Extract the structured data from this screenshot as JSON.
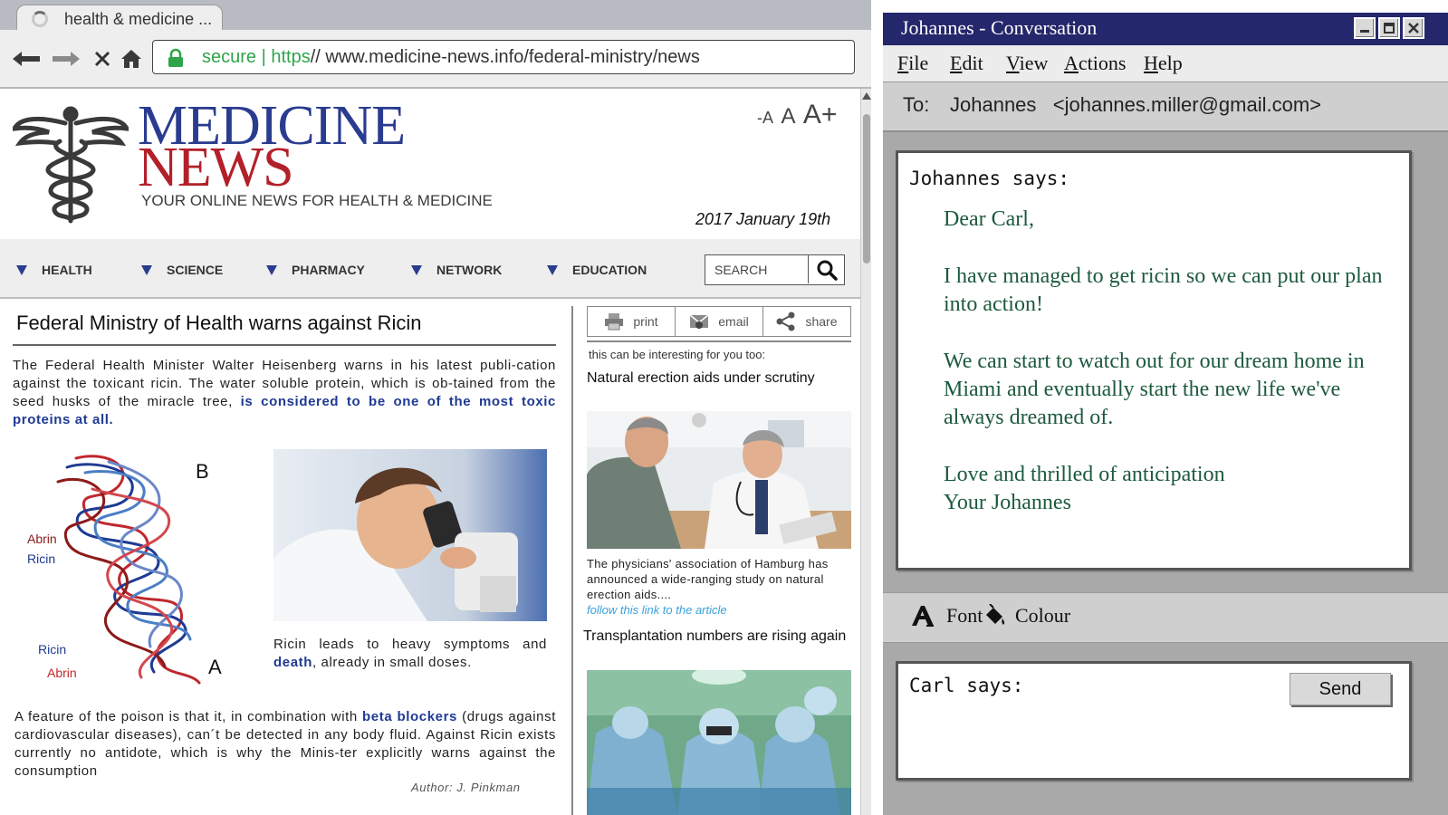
{
  "browser": {
    "tab_title": "health & medicine ...",
    "address": {
      "secure_label": "secure | https",
      "url_rest": "// www.medicine-news.info/federal-ministry/news"
    }
  },
  "site": {
    "brand_line1": "MEDICINE",
    "brand_line2": "NEWS",
    "tagline": "YOUR ONLINE NEWS FOR HEALTH & MEDICINE",
    "font_controls": [
      "-A",
      "A",
      "A+"
    ],
    "date": "2017 January 19th",
    "nav": [
      "HEALTH",
      "SCIENCE",
      "PHARMACY",
      "NETWORK",
      "EDUCATION"
    ],
    "search_placeholder": "SEARCH",
    "colors": {
      "brand_blue": "#2a3c8f",
      "brand_red": "#b3202a",
      "link_blue": "#1f3a93"
    }
  },
  "article": {
    "title": "Federal Ministry of Health warns against Ricin",
    "intro": "The Federal Health Minister Walter Heisenberg warns in his latest publi-cation  against the toxicant ricin. The water soluble protein, which is ob-tained from the seed husks of the miracle tree, ",
    "intro_highlight": "is considered to be one of the most toxic proteins at all.",
    "figure_labels": {
      "b": "B",
      "a": "A",
      "abrin_top": "Abrin",
      "ricin_top": "Ricin",
      "ricin_bottom": "Ricin",
      "abrin_bottom": "Abrin"
    },
    "caption_pre": "Ricin leads to heavy symptoms and ",
    "caption_highlight": "death",
    "caption_post": ", already in small doses.",
    "body2_pre": "A feature of the poison is that it, in combination with ",
    "body2_highlight": "beta blockers",
    "body2_post": " (drugs against cardiovascular diseases), can´t be detected in any body fluid. Against Ricin exists currently no antidote, which is why the Minis-ter explicitly warns against the consumption",
    "author": "Author: J. Pinkman"
  },
  "sidebar": {
    "share_buttons": [
      "print",
      "email",
      "share"
    ],
    "intro": "this can be interesting for you too:",
    "item1_title": "Natural erection aids under scrutiny",
    "item1_text": "The physicians' association of Hamburg has announced a wide-ranging study on natural erection aids....",
    "item1_link": "follow this link to the article",
    "item2_title": "Transplantation numbers are rising again"
  },
  "chat": {
    "title": "Johannes - Conversation",
    "menu": [
      {
        "first": "F",
        "rest": "ile"
      },
      {
        "first": "E",
        "rest": "dit"
      },
      {
        "first": "V",
        "rest": "iew"
      },
      {
        "first": "A",
        "rest": "ctions"
      },
      {
        "first": "H",
        "rest": "elp"
      }
    ],
    "to_label": "To:",
    "to_value": "Johannes   <johannes.miller@gmail.com>",
    "incoming_label": "Johannes says:",
    "message_lines": [
      "Dear Carl,",
      "I have managed to get ricin so we can put our plan into action!",
      "We can start to watch out for our dream home in Miami and eventually start the new life we've always dreamed of.",
      "Love and thrilled of anticipation"
    ],
    "signature": "Your Johannes",
    "format_font": "Font",
    "format_colour": "Colour",
    "outgoing_label": "Carl says:",
    "send_label": "Send",
    "colors": {
      "titlebar": "#24276b",
      "message_text": "#1d5a3d"
    }
  }
}
